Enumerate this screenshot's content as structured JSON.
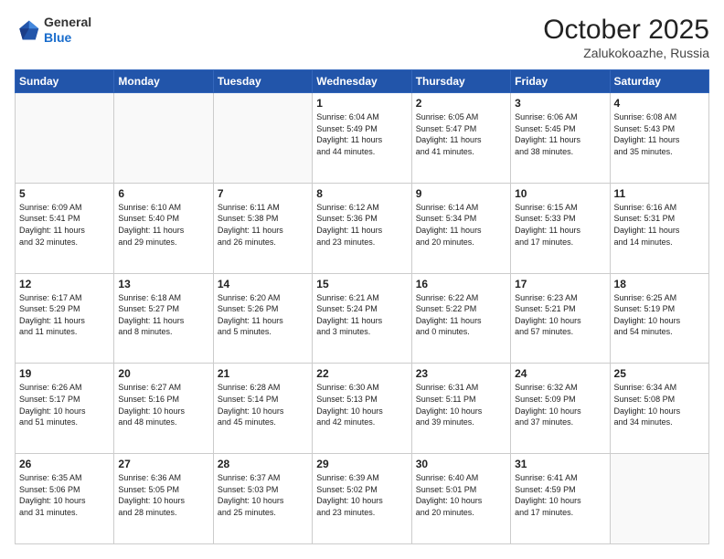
{
  "header": {
    "logo_general": "General",
    "logo_blue": "Blue",
    "month_title": "October 2025",
    "location": "Zalukokoazhe, Russia"
  },
  "days_of_week": [
    "Sunday",
    "Monday",
    "Tuesday",
    "Wednesday",
    "Thursday",
    "Friday",
    "Saturday"
  ],
  "weeks": [
    [
      {
        "day": "",
        "info": ""
      },
      {
        "day": "",
        "info": ""
      },
      {
        "day": "",
        "info": ""
      },
      {
        "day": "1",
        "info": "Sunrise: 6:04 AM\nSunset: 5:49 PM\nDaylight: 11 hours\nand 44 minutes."
      },
      {
        "day": "2",
        "info": "Sunrise: 6:05 AM\nSunset: 5:47 PM\nDaylight: 11 hours\nand 41 minutes."
      },
      {
        "day": "3",
        "info": "Sunrise: 6:06 AM\nSunset: 5:45 PM\nDaylight: 11 hours\nand 38 minutes."
      },
      {
        "day": "4",
        "info": "Sunrise: 6:08 AM\nSunset: 5:43 PM\nDaylight: 11 hours\nand 35 minutes."
      }
    ],
    [
      {
        "day": "5",
        "info": "Sunrise: 6:09 AM\nSunset: 5:41 PM\nDaylight: 11 hours\nand 32 minutes."
      },
      {
        "day": "6",
        "info": "Sunrise: 6:10 AM\nSunset: 5:40 PM\nDaylight: 11 hours\nand 29 minutes."
      },
      {
        "day": "7",
        "info": "Sunrise: 6:11 AM\nSunset: 5:38 PM\nDaylight: 11 hours\nand 26 minutes."
      },
      {
        "day": "8",
        "info": "Sunrise: 6:12 AM\nSunset: 5:36 PM\nDaylight: 11 hours\nand 23 minutes."
      },
      {
        "day": "9",
        "info": "Sunrise: 6:14 AM\nSunset: 5:34 PM\nDaylight: 11 hours\nand 20 minutes."
      },
      {
        "day": "10",
        "info": "Sunrise: 6:15 AM\nSunset: 5:33 PM\nDaylight: 11 hours\nand 17 minutes."
      },
      {
        "day": "11",
        "info": "Sunrise: 6:16 AM\nSunset: 5:31 PM\nDaylight: 11 hours\nand 14 minutes."
      }
    ],
    [
      {
        "day": "12",
        "info": "Sunrise: 6:17 AM\nSunset: 5:29 PM\nDaylight: 11 hours\nand 11 minutes."
      },
      {
        "day": "13",
        "info": "Sunrise: 6:18 AM\nSunset: 5:27 PM\nDaylight: 11 hours\nand 8 minutes."
      },
      {
        "day": "14",
        "info": "Sunrise: 6:20 AM\nSunset: 5:26 PM\nDaylight: 11 hours\nand 5 minutes."
      },
      {
        "day": "15",
        "info": "Sunrise: 6:21 AM\nSunset: 5:24 PM\nDaylight: 11 hours\nand 3 minutes."
      },
      {
        "day": "16",
        "info": "Sunrise: 6:22 AM\nSunset: 5:22 PM\nDaylight: 11 hours\nand 0 minutes."
      },
      {
        "day": "17",
        "info": "Sunrise: 6:23 AM\nSunset: 5:21 PM\nDaylight: 10 hours\nand 57 minutes."
      },
      {
        "day": "18",
        "info": "Sunrise: 6:25 AM\nSunset: 5:19 PM\nDaylight: 10 hours\nand 54 minutes."
      }
    ],
    [
      {
        "day": "19",
        "info": "Sunrise: 6:26 AM\nSunset: 5:17 PM\nDaylight: 10 hours\nand 51 minutes."
      },
      {
        "day": "20",
        "info": "Sunrise: 6:27 AM\nSunset: 5:16 PM\nDaylight: 10 hours\nand 48 minutes."
      },
      {
        "day": "21",
        "info": "Sunrise: 6:28 AM\nSunset: 5:14 PM\nDaylight: 10 hours\nand 45 minutes."
      },
      {
        "day": "22",
        "info": "Sunrise: 6:30 AM\nSunset: 5:13 PM\nDaylight: 10 hours\nand 42 minutes."
      },
      {
        "day": "23",
        "info": "Sunrise: 6:31 AM\nSunset: 5:11 PM\nDaylight: 10 hours\nand 39 minutes."
      },
      {
        "day": "24",
        "info": "Sunrise: 6:32 AM\nSunset: 5:09 PM\nDaylight: 10 hours\nand 37 minutes."
      },
      {
        "day": "25",
        "info": "Sunrise: 6:34 AM\nSunset: 5:08 PM\nDaylight: 10 hours\nand 34 minutes."
      }
    ],
    [
      {
        "day": "26",
        "info": "Sunrise: 6:35 AM\nSunset: 5:06 PM\nDaylight: 10 hours\nand 31 minutes."
      },
      {
        "day": "27",
        "info": "Sunrise: 6:36 AM\nSunset: 5:05 PM\nDaylight: 10 hours\nand 28 minutes."
      },
      {
        "day": "28",
        "info": "Sunrise: 6:37 AM\nSunset: 5:03 PM\nDaylight: 10 hours\nand 25 minutes."
      },
      {
        "day": "29",
        "info": "Sunrise: 6:39 AM\nSunset: 5:02 PM\nDaylight: 10 hours\nand 23 minutes."
      },
      {
        "day": "30",
        "info": "Sunrise: 6:40 AM\nSunset: 5:01 PM\nDaylight: 10 hours\nand 20 minutes."
      },
      {
        "day": "31",
        "info": "Sunrise: 6:41 AM\nSunset: 4:59 PM\nDaylight: 10 hours\nand 17 minutes."
      },
      {
        "day": "",
        "info": ""
      }
    ]
  ]
}
